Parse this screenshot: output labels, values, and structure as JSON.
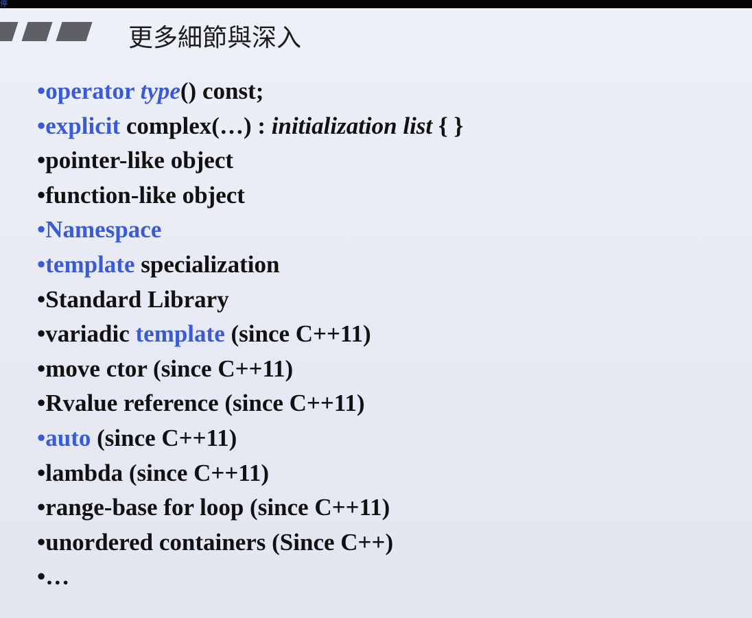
{
  "corner_glyph": "停",
  "title": "更多細節與深入",
  "colors": {
    "accent_blue": "#3b5bd6",
    "text": "#111111",
    "deco_gray": "#5f6066"
  },
  "items": [
    {
      "segments": [
        {
          "text": "•operator ",
          "blue": true
        },
        {
          "text": "type",
          "blue": true,
          "italic": true
        },
        {
          "text": "() const;"
        }
      ]
    },
    {
      "segments": [
        {
          "text": "•explicit",
          "blue": true
        },
        {
          "text": " complex(…) : "
        },
        {
          "text": "initialization list",
          "italic": true
        },
        {
          "text": " {  }"
        }
      ]
    },
    {
      "segments": [
        {
          "text": "•pointer-like object"
        }
      ]
    },
    {
      "segments": [
        {
          "text": "•function-like object"
        }
      ]
    },
    {
      "segments": [
        {
          "text": "•Namespace",
          "blue": true
        }
      ]
    },
    {
      "segments": [
        {
          "text": "•template",
          "blue": true
        },
        {
          "text": " specialization"
        }
      ]
    },
    {
      "segments": [
        {
          "text": "•Standard Library"
        }
      ]
    },
    {
      "segments": [
        {
          "text": "•variadic "
        },
        {
          "text": "template",
          "blue": true
        },
        {
          "text": " (since C++11)"
        }
      ]
    },
    {
      "segments": [
        {
          "text": "•move ctor (since C++11)"
        }
      ]
    },
    {
      "segments": [
        {
          "text": "•Rvalue reference (since C++11)"
        }
      ]
    },
    {
      "segments": [
        {
          "text": "•auto",
          "blue": true
        },
        {
          "text": " (since C++11)"
        }
      ]
    },
    {
      "segments": [
        {
          "text": "•lambda (since C++11)"
        }
      ]
    },
    {
      "segments": [
        {
          "text": "•range-base for loop (since C++11)"
        }
      ]
    },
    {
      "segments": [
        {
          "text": "•unordered containers (Since C++)"
        }
      ]
    },
    {
      "segments": [
        {
          "text": "•…"
        }
      ]
    }
  ]
}
